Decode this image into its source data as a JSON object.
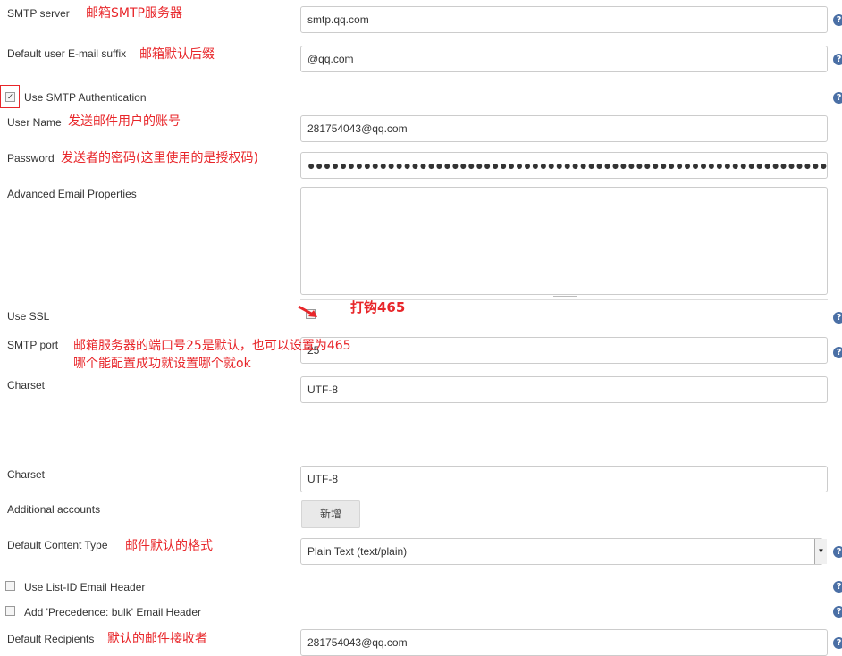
{
  "smtp_server": {
    "label": "SMTP server",
    "note": "邮箱SMTP服务器",
    "value": "smtp.qq.com"
  },
  "email_suffix": {
    "label": "Default user E-mail suffix",
    "note": "邮箱默认后缀",
    "value": "@qq.com"
  },
  "smtp_auth": {
    "label": "Use SMTP Authentication",
    "checked": true
  },
  "user_name": {
    "label": "User Name",
    "note": "发送邮件用户的账号",
    "value": "281754043@qq.com"
  },
  "password": {
    "label": "Password",
    "note": "发送者的密码(这里使用的是授权码)",
    "value": "●●●●●●●●●●●●●●●●●●●●●●●●●●●●●●●●●●●●●●●●●●●●●●●●●●●●●●●●●●●●●●●●●●●●●●●●●●"
  },
  "advanced_props": {
    "label": "Advanced Email Properties",
    "value": ""
  },
  "use_ssl": {
    "label": "Use SSL",
    "note": "打钩465",
    "checked": false
  },
  "smtp_port": {
    "label": "SMTP port",
    "note_line1": "邮箱服务器的端口号25是默认，也可以设置为465",
    "note_line2": "哪个能配置成功就设置哪个就ok",
    "value": "25"
  },
  "charset_1": {
    "label": "Charset",
    "value": "UTF-8"
  },
  "charset_2": {
    "label": "Charset",
    "value": "UTF-8"
  },
  "additional_accounts": {
    "label": "Additional accounts",
    "button": "新增"
  },
  "content_type": {
    "label": "Default Content Type",
    "note": "邮件默认的格式",
    "value": "Plain Text (text/plain)"
  },
  "list_id_header": {
    "label": "Use List-ID Email Header",
    "checked": false
  },
  "precedence_header": {
    "label": "Add 'Precedence: bulk' Email Header",
    "checked": false
  },
  "default_recipients": {
    "label": "Default Recipients",
    "note": "默认的邮件接收者",
    "value": "281754043@qq.com"
  },
  "help_glyph": "?",
  "colors": {
    "annotation": "#e8262a",
    "help": "#4a6fa5"
  }
}
